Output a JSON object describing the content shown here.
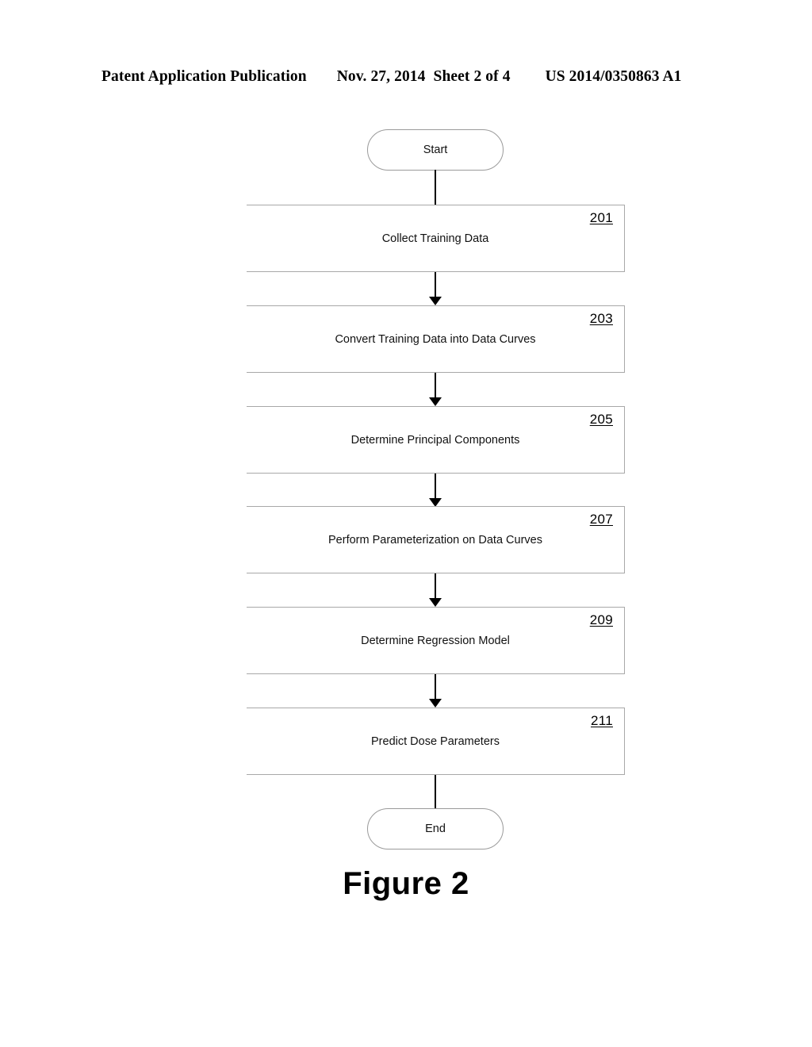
{
  "header": {
    "publication": "Patent Application Publication",
    "date": "Nov. 27, 2014",
    "sheet": "Sheet 2 of 4",
    "patent_number": "US 2014/0350863 A1"
  },
  "figure": {
    "caption": "Figure 2",
    "start_label": "Start",
    "end_label": "End"
  },
  "flowchart": {
    "type": "flowchart",
    "orientation": "vertical",
    "steps": [
      {
        "ref": "201",
        "label": "Collect Training Data"
      },
      {
        "ref": "203",
        "label": "Convert Training Data into Data Curves"
      },
      {
        "ref": "205",
        "label": "Determine Principal Components"
      },
      {
        "ref": "207",
        "label": "Perform Parameterization on Data Curves"
      },
      {
        "ref": "209",
        "label": "Determine Regression Model"
      },
      {
        "ref": "211",
        "label": "Predict Dose Parameters"
      }
    ]
  }
}
